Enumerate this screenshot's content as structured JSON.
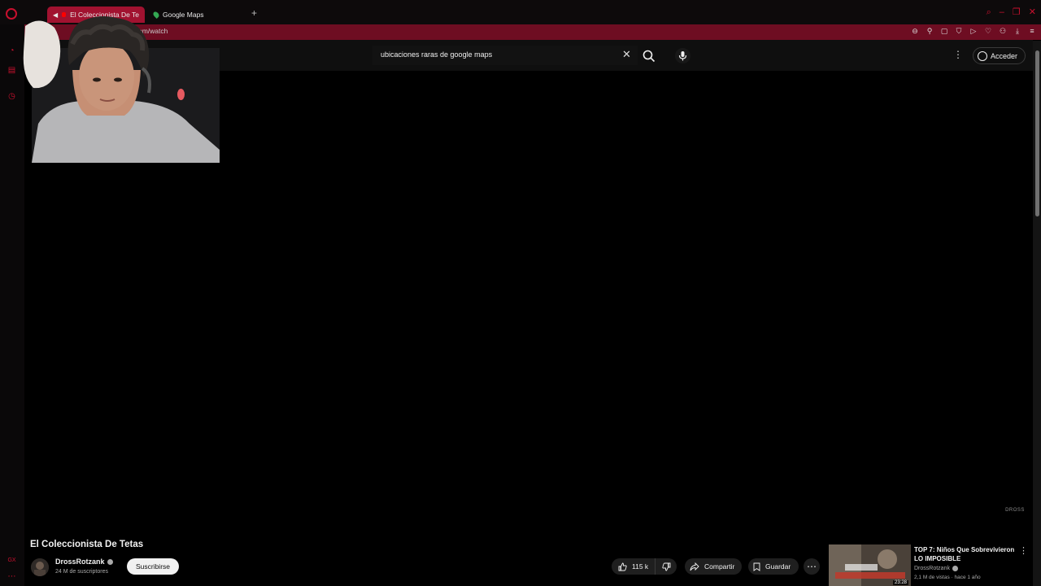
{
  "browser": {
    "tabs": [
      {
        "label": "El Coleccionista De Te",
        "active": true
      },
      {
        "label": "Google Maps",
        "active": false
      }
    ],
    "url": "om/watch",
    "accent": "#c8102e"
  },
  "youtube": {
    "search": {
      "value": "ubicaciones raras de google maps"
    },
    "signin_label": "Acceder"
  },
  "player": {
    "watermark": "DROSS"
  },
  "video": {
    "title": "El Coleccionista De Tetas",
    "channel": "DrossRotzank",
    "subscribers": "24 M de suscriptores",
    "subscribe_label": "Suscribirse",
    "likes": "115 k",
    "share_label": "Compartir",
    "save_label": "Guardar"
  },
  "recommendation": {
    "title": "TOP 7: Niños Que Sobrevivieron LO IMPOSIBLE",
    "channel": "DrossRotzank",
    "meta": "2,1 M de vistas · hace 1 año",
    "duration": "23:28"
  }
}
